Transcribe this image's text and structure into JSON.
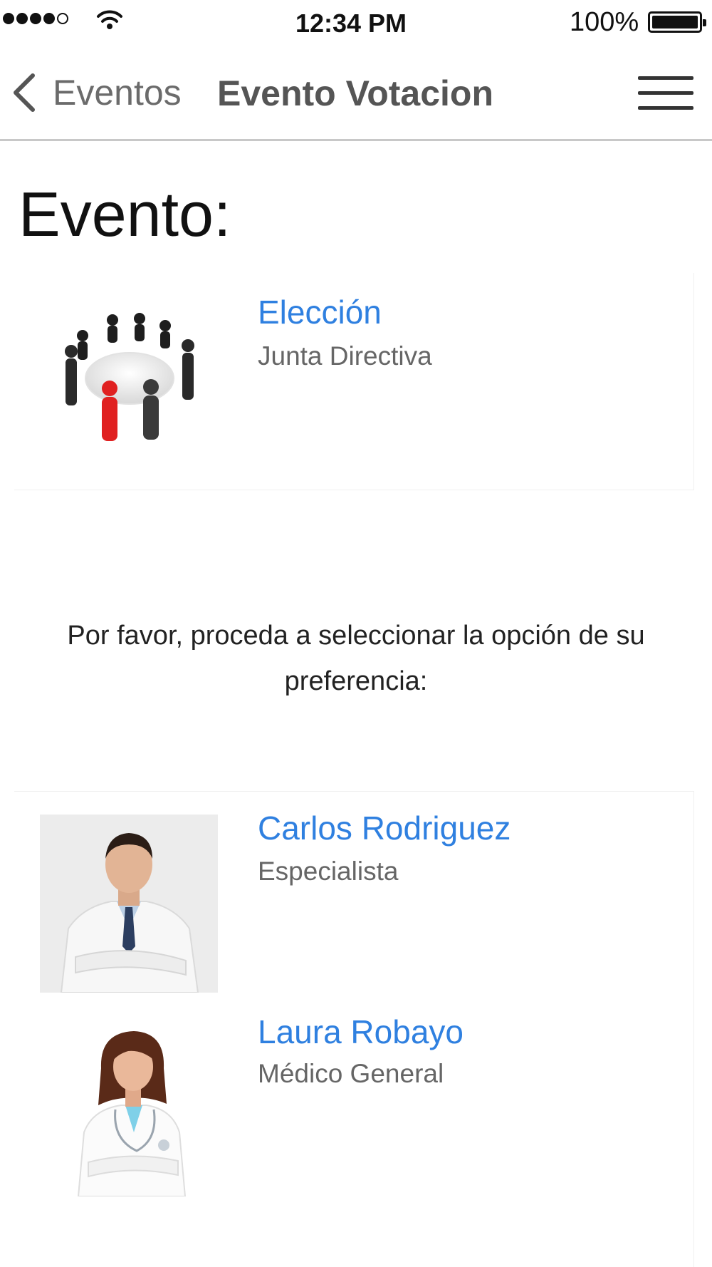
{
  "status_bar": {
    "time": "12:34 PM",
    "battery": "100%"
  },
  "nav": {
    "back_label": "Eventos",
    "title": "Evento Votacion"
  },
  "page": {
    "section_title": "Evento:",
    "instruction": "Por favor, proceda a seleccionar la opción de su preferencia:"
  },
  "event": {
    "title": "Elección",
    "subtitle": "Junta Directiva"
  },
  "candidates": [
    {
      "name": "Carlos Rodriguez",
      "role": "Especialista"
    },
    {
      "name": "Laura Robayo",
      "role": "Médico General"
    }
  ],
  "colors": {
    "accent": "#2f80e0",
    "divider": "#c8c8c8"
  }
}
